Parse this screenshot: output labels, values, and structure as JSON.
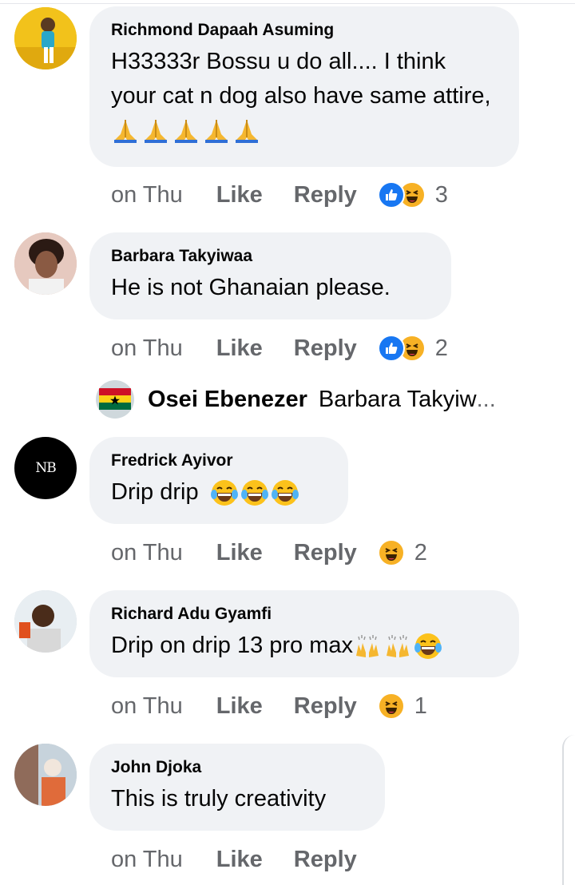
{
  "comments": [
    {
      "author": "Richmond Dapaah Asuming",
      "text": "H33333r Bossu u do all.... I think your cat n dog also have same attire,",
      "time": "on Thu",
      "like_label": "Like",
      "reply_label": "Reply",
      "reactions": [
        "like",
        "haha"
      ],
      "reaction_count": "3"
    },
    {
      "author": "Barbara Takyiwaa",
      "text": "He is not Ghanaian please.",
      "time": "on Thu",
      "like_label": "Like",
      "reply_label": "Reply",
      "reactions": [
        "like",
        "haha"
      ],
      "reaction_count": "2"
    },
    {
      "author": "Fredrick Ayivor",
      "text": "Drip drip",
      "time": "on Thu",
      "like_label": "Like",
      "reply_label": "Reply",
      "reactions": [
        "haha"
      ],
      "reaction_count": "2"
    },
    {
      "author": "Richard Adu Gyamfi",
      "text": "Drip on drip 13 pro max",
      "time": "on Thu",
      "like_label": "Like",
      "reply_label": "Reply",
      "reactions": [
        "haha"
      ],
      "reaction_count": "1"
    },
    {
      "author": "John Djoka",
      "text": "This is truly creativity",
      "time": "on Thu",
      "like_label": "Like",
      "reply_label": "Reply",
      "reactions": [],
      "reaction_count": ""
    }
  ],
  "reply_preview": {
    "author": "Osei Ebenezer",
    "text": "Barbara Takyiw",
    "ellipsis": "..."
  },
  "avatars": {
    "fredrick_logo": "NB"
  },
  "colors": {
    "bubble": "#f0f2f5",
    "meta_text": "#65676b",
    "like_blue": "#1877f2",
    "haha_yellow": "#f7b125"
  }
}
